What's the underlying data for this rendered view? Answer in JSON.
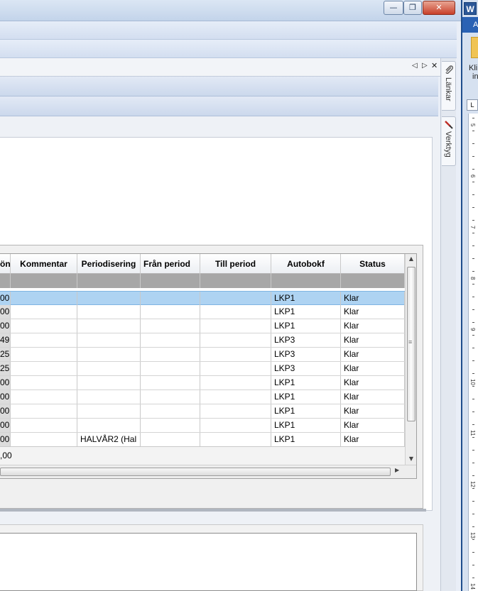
{
  "window": {
    "minimize_glyph": "—",
    "restore_glyph": "❐",
    "close_glyph": "✕"
  },
  "tabstrip": {
    "prev_glyph": "◁",
    "next_glyph": "▷",
    "close_glyph": "✕"
  },
  "side_tabs": [
    {
      "label": "Länkar",
      "icon": "paperclip-icon"
    },
    {
      "label": "Verktyg",
      "icon": "tools-icon"
    }
  ],
  "grid": {
    "columns": [
      "ön",
      "Kommentar",
      "Periodisering",
      "Från period",
      "Till period",
      "Autobokf",
      "Status"
    ],
    "rows": [
      {
        "amount": "00",
        "kommentar": "",
        "periodisering": "",
        "fran": "",
        "till": "",
        "autobokf": "LKP1",
        "status": "Klar",
        "selected": true
      },
      {
        "amount": "00",
        "kommentar": "",
        "periodisering": "",
        "fran": "",
        "till": "",
        "autobokf": "LKP1",
        "status": "Klar"
      },
      {
        "amount": "00",
        "kommentar": "",
        "periodisering": "",
        "fran": "",
        "till": "",
        "autobokf": "LKP1",
        "status": "Klar"
      },
      {
        "amount": "49",
        "kommentar": "",
        "periodisering": "",
        "fran": "",
        "till": "",
        "autobokf": "LKP3",
        "status": "Klar"
      },
      {
        "amount": "25",
        "kommentar": "",
        "periodisering": "",
        "fran": "",
        "till": "",
        "autobokf": "LKP3",
        "status": "Klar"
      },
      {
        "amount": "25",
        "kommentar": "",
        "periodisering": "",
        "fran": "",
        "till": "",
        "autobokf": "LKP3",
        "status": "Klar"
      },
      {
        "amount": "00",
        "kommentar": "",
        "periodisering": "",
        "fran": "",
        "till": "",
        "autobokf": "LKP1",
        "status": "Klar"
      },
      {
        "amount": "00",
        "kommentar": "",
        "periodisering": "",
        "fran": "",
        "till": "",
        "autobokf": "LKP1",
        "status": "Klar"
      },
      {
        "amount": "00",
        "kommentar": "",
        "periodisering": "",
        "fran": "",
        "till": "",
        "autobokf": "LKP1",
        "status": "Klar"
      },
      {
        "amount": "00",
        "kommentar": "",
        "periodisering": "",
        "fran": "",
        "till": "",
        "autobokf": "LKP1",
        "status": "Klar"
      },
      {
        "amount": "00",
        "kommentar": "",
        "periodisering": "HALVÅR2 (Hal",
        "fran": "",
        "till": "",
        "autobokf": "LKP1",
        "status": "Klar"
      }
    ],
    "summary_total": ",00",
    "scroll_up": "▲",
    "scroll_down": "▼",
    "scroll_right": "▶",
    "thumb_grip": "≡"
  },
  "word": {
    "logo": "W",
    "tab_label": "A",
    "folder_text_1": "Kli",
    "folder_text_2": "in",
    "ruler_corner": "L",
    "ruler_numbers": [
      "5",
      "6",
      "7",
      "8",
      "9",
      "10",
      "11",
      "12",
      "13",
      "14"
    ]
  }
}
